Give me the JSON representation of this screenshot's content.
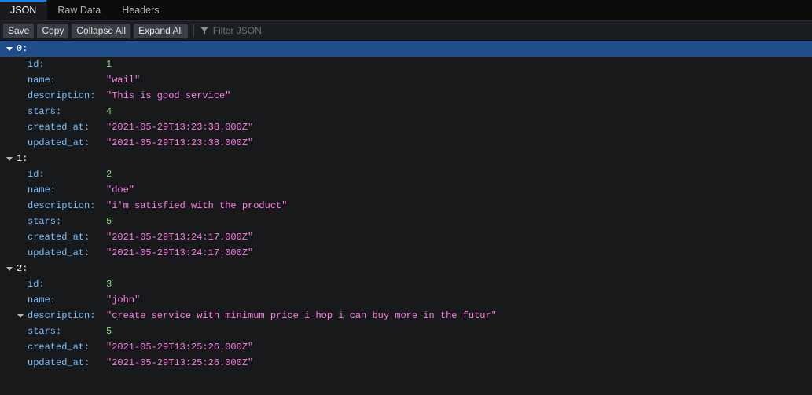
{
  "tabs": [
    {
      "label": "JSON",
      "name": "tab-json",
      "active": true
    },
    {
      "label": "Raw Data",
      "name": "tab-raw-data",
      "active": false
    },
    {
      "label": "Headers",
      "name": "tab-headers",
      "active": false
    }
  ],
  "toolbar": {
    "save_label": "Save",
    "copy_label": "Copy",
    "collapse_all_label": "Collapse All",
    "expand_all_label": "Expand All",
    "filter_placeholder": "Filter JSON",
    "filter_value": "",
    "filter_icon": "filter-funnel-icon"
  },
  "colors": {
    "accent": "#0a84ff",
    "selection": "#204e8a",
    "key": "#75bfff",
    "string": "#ff7de9",
    "number": "#86de74",
    "panel_bg": "#18191b",
    "toolbar_bg": "#1a1d21",
    "tabbar_bg": "#0c0c0d"
  },
  "json_rows": [
    {
      "depth": 0,
      "twisty": "expanded",
      "key": "0:",
      "selected": true
    },
    {
      "depth": 1,
      "twisty": null,
      "key": "id:",
      "value": "1",
      "type": "number"
    },
    {
      "depth": 1,
      "twisty": null,
      "key": "name:",
      "value": "\"wail\"",
      "type": "string"
    },
    {
      "depth": 1,
      "twisty": null,
      "key": "description:",
      "value": "\"This is good service\"",
      "type": "string"
    },
    {
      "depth": 1,
      "twisty": null,
      "key": "stars:",
      "value": "4",
      "type": "number"
    },
    {
      "depth": 1,
      "twisty": null,
      "key": "created_at:",
      "value": "\"2021-05-29T13:23:38.000Z\"",
      "type": "string"
    },
    {
      "depth": 1,
      "twisty": null,
      "key": "updated_at:",
      "value": "\"2021-05-29T13:23:38.000Z\"",
      "type": "string"
    },
    {
      "depth": 0,
      "twisty": "expanded",
      "key": "1:",
      "selected": false
    },
    {
      "depth": 1,
      "twisty": null,
      "key": "id:",
      "value": "2",
      "type": "number"
    },
    {
      "depth": 1,
      "twisty": null,
      "key": "name:",
      "value": "\"doe\"",
      "type": "string"
    },
    {
      "depth": 1,
      "twisty": null,
      "key": "description:",
      "value": "\"i'm satisfied with the product\"",
      "type": "string"
    },
    {
      "depth": 1,
      "twisty": null,
      "key": "stars:",
      "value": "5",
      "type": "number"
    },
    {
      "depth": 1,
      "twisty": null,
      "key": "created_at:",
      "value": "\"2021-05-29T13:24:17.000Z\"",
      "type": "string"
    },
    {
      "depth": 1,
      "twisty": null,
      "key": "updated_at:",
      "value": "\"2021-05-29T13:24:17.000Z\"",
      "type": "string"
    },
    {
      "depth": 0,
      "twisty": "expanded",
      "key": "2:",
      "selected": false
    },
    {
      "depth": 1,
      "twisty": null,
      "key": "id:",
      "value": "3",
      "type": "number"
    },
    {
      "depth": 1,
      "twisty": null,
      "key": "name:",
      "value": "\"john\"",
      "type": "string"
    },
    {
      "depth": 1,
      "twisty": "expanded",
      "key": "description:",
      "value": "\"create service with minimum price i hop i can buy more in the futur\"",
      "type": "string"
    },
    {
      "depth": 1,
      "twisty": null,
      "key": "stars:",
      "value": "5",
      "type": "number"
    },
    {
      "depth": 1,
      "twisty": null,
      "key": "created_at:",
      "value": "\"2021-05-29T13:25:26.000Z\"",
      "type": "string"
    },
    {
      "depth": 1,
      "twisty": null,
      "key": "updated_at:",
      "value": "\"2021-05-29T13:25:26.000Z\"",
      "type": "string"
    }
  ]
}
